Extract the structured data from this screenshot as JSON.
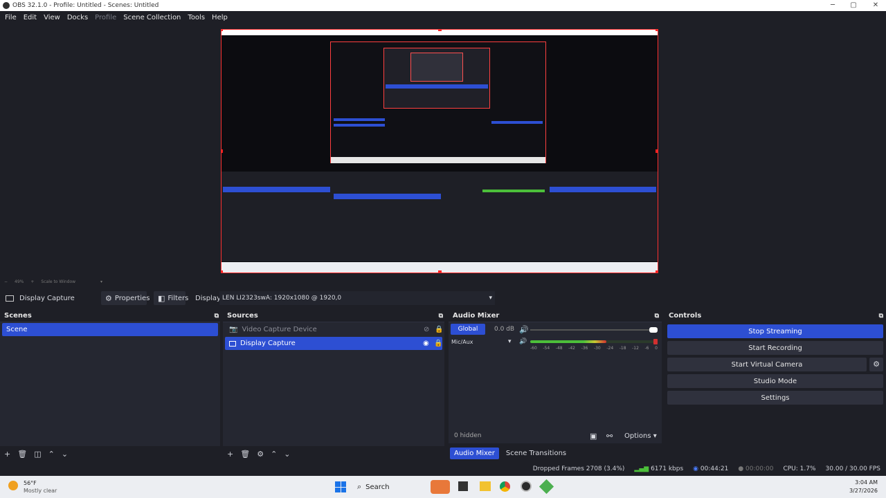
{
  "window": {
    "title": "OBS 32.1.0 - Profile: Untitled - Scenes: Untitled",
    "minimize": "─",
    "maximize": "▢",
    "close": "✕"
  },
  "menu": [
    "File",
    "Edit",
    "View",
    "Docks",
    "Profile",
    "Scene Collection",
    "Tools",
    "Help"
  ],
  "preview": {
    "zoom": "49%",
    "scale_label": "Scale to Window"
  },
  "source_toolbar": {
    "source_name": "Display Capture",
    "properties": "Properties",
    "filters": "Filters",
    "display_label": "Display",
    "display_value": "LEN LI2323swA: 1920x1080 @ 1920,0"
  },
  "scenes": {
    "title": "Scenes",
    "items": [
      {
        "label": "Scene",
        "selected": true
      }
    ]
  },
  "sources": {
    "title": "Sources",
    "items": [
      {
        "label": "Video Capture Device",
        "visible": false,
        "selected": false
      },
      {
        "label": "Display Capture",
        "visible": true,
        "selected": true
      }
    ]
  },
  "audio_mixer": {
    "title": "Audio Mixer",
    "channels": [
      {
        "name": "Global",
        "db": "0.0 dB",
        "volume": 1.0
      },
      {
        "name": "Mic/Aux",
        "db": "",
        "volume": 1.0,
        "level": 0.6
      }
    ],
    "meter_ticks": [
      "-60",
      "-54",
      "-48",
      "-42",
      "-36",
      "-30",
      "-24",
      "-18",
      "-12",
      "-6",
      "0"
    ],
    "hidden_count": "0 hidden",
    "options": "Options",
    "tab_mixer": "Audio Mixer",
    "tab_transitions": "Scene Transitions"
  },
  "controls": {
    "title": "Controls",
    "stop_streaming": "Stop Streaming",
    "start_recording": "Start Recording",
    "start_virtual_camera": "Start Virtual Camera",
    "studio_mode": "Studio Mode",
    "settings": "Settings"
  },
  "status": {
    "dropped_frames": "Dropped Frames 2708 (3.4%)",
    "bitrate": "6171 kbps",
    "stream_time": "00:44:21",
    "record_time": "00:00:00",
    "cpu": "CPU: 1.7%",
    "fps": "30.00 / 30.00 FPS"
  },
  "taskbar": {
    "weather_temp": "56°F",
    "weather_desc": "Mostly clear",
    "search": "Search",
    "time": "3:04 AM",
    "date": "3/27/2026"
  },
  "colors": {
    "accent": "#2d4fd3",
    "preview_border": "#ff3030",
    "meter_green": "#4cbf3a",
    "meter_yellow": "#c8c832",
    "meter_red": "#d03030"
  }
}
